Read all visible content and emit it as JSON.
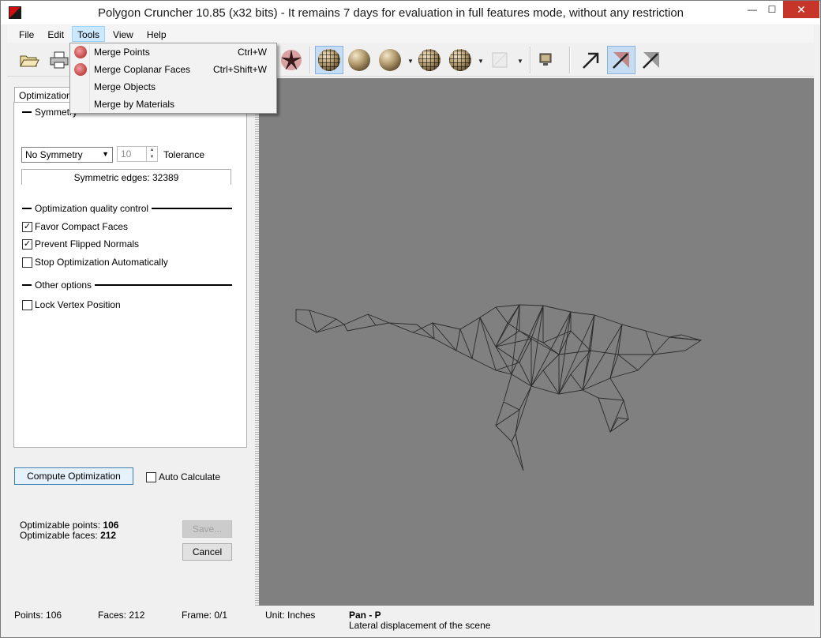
{
  "window": {
    "title": "Polygon Cruncher 10.85 (x32 bits) - It remains 7 days for evaluation in full features mode, without any restriction",
    "controls": {
      "minimize": "—",
      "maximize": "☐",
      "close": "✕"
    }
  },
  "menubar": {
    "items": [
      {
        "label": "File"
      },
      {
        "label": "Edit"
      },
      {
        "label": "Tools"
      },
      {
        "label": "View"
      },
      {
        "label": "Help"
      }
    ]
  },
  "tools_menu": {
    "items": [
      {
        "label": "Merge Points",
        "shortcut": "Ctrl+W",
        "icon": "merge-points-icon"
      },
      {
        "label": "Merge Coplanar Faces",
        "shortcut": "Ctrl+Shift+W",
        "icon": "merge-coplanar-icon"
      },
      {
        "label": "Merge Objects",
        "shortcut": ""
      },
      {
        "label": "Merge by Materials",
        "shortcut": ""
      }
    ]
  },
  "toolbar": {
    "icons": [
      "open-folder-icon",
      "print-icon",
      "star-icon",
      "wire-sphere-icon",
      "flat-sphere-icon",
      "smooth-sphere-icon",
      "wire-smooth-sphere-icon",
      "wire-flat-sphere-icon",
      "texture-icon",
      "monitor-icon",
      "arrow-tool-icon",
      "arrow-select-icon",
      "arrow-gray-icon"
    ]
  },
  "panel": {
    "tab_label": "Optimization",
    "symmetry": {
      "title": "Symmetry",
      "select_value": "No Symmetry",
      "tolerance_value": "10",
      "tolerance_label": "Tolerance",
      "symmetric_edges": "Symmetric edges: 32389"
    },
    "quality": {
      "title": "Optimization quality control",
      "favor_compact": "Favor Compact Faces",
      "prevent_flipped": "Prevent Flipped Normals",
      "stop_auto": "Stop Optimization Automatically"
    },
    "other": {
      "title": "Other options",
      "lock_vertex": "Lock Vertex Position"
    },
    "compute_button": "Compute Optimization",
    "auto_calculate": "Auto Calculate",
    "optimizable_points_label": "Optimizable points:",
    "optimizable_points": "106",
    "optimizable_faces_label": "Optimizable faces:",
    "optimizable_faces": "212",
    "save_button": "Save...",
    "cancel_button": "Cancel"
  },
  "statusbar": {
    "points": "Points: 106",
    "faces": "Faces: 212",
    "frame": "Frame: 0/1",
    "unit": "Unit: Inches",
    "tool_name": "Pan - P",
    "tool_desc": "Lateral displacement of the scene"
  }
}
